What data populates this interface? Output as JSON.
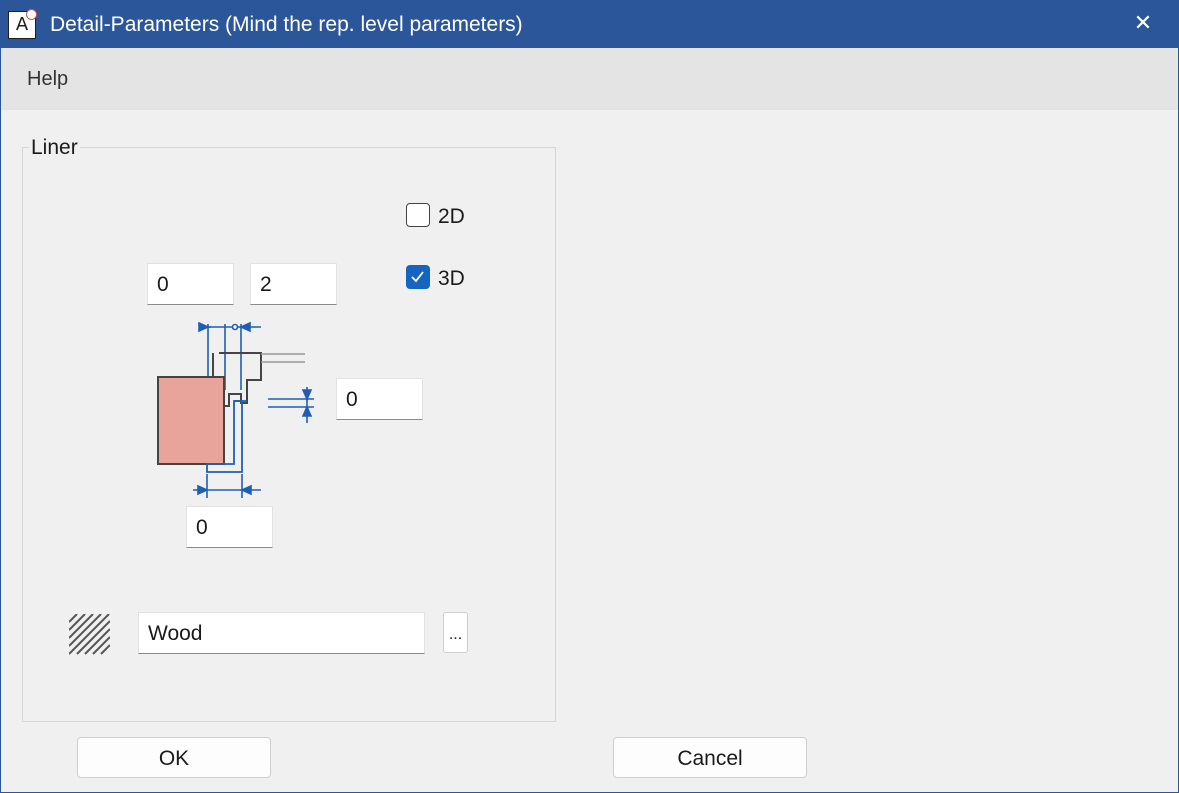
{
  "window": {
    "title": "Detail-Parameters (Mind the rep. level parameters)",
    "app_icon_letter": "A",
    "close_glyph": "✕"
  },
  "menu": {
    "items": [
      "Help"
    ]
  },
  "liner": {
    "label": "Liner",
    "option_2d": {
      "label": "2D",
      "checked": false
    },
    "option_3d": {
      "label": "3D",
      "checked": true
    },
    "field_top_left": "0",
    "field_top_right": "2",
    "field_right": "0",
    "field_bottom": "0",
    "material": "Wood",
    "browse_label": "..."
  },
  "buttons": {
    "ok": "OK",
    "cancel": "Cancel"
  },
  "colors": {
    "titlebar": "#2b579a",
    "accent_check": "#1565c0",
    "dimension_lines": "#1f5fb3",
    "wall_fill": "#e8a39a"
  }
}
